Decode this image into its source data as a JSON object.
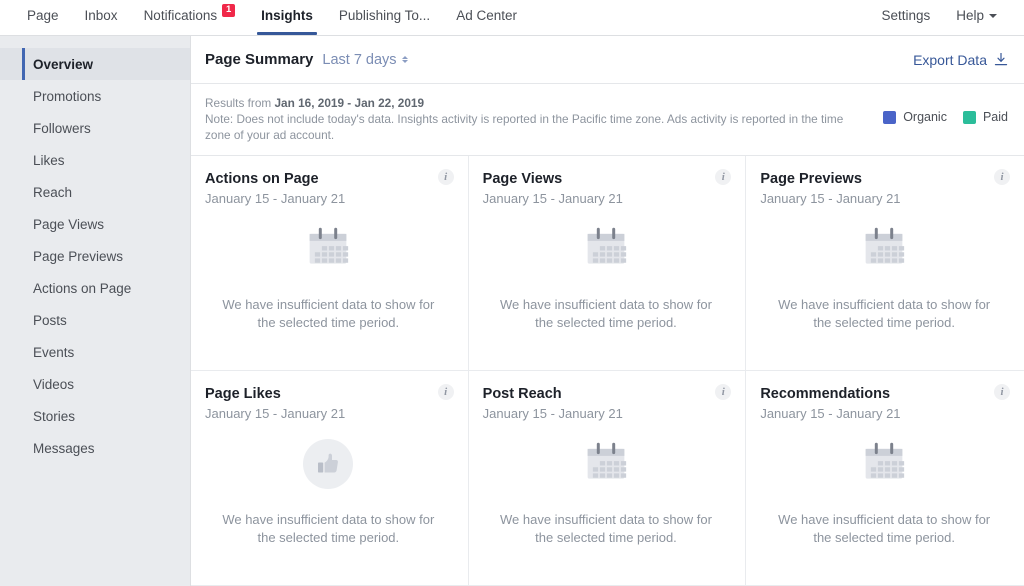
{
  "topnav": {
    "tabs": [
      {
        "label": "Page",
        "active": false,
        "badge": null
      },
      {
        "label": "Inbox",
        "active": false,
        "badge": null
      },
      {
        "label": "Notifications",
        "active": false,
        "badge": "1"
      },
      {
        "label": "Insights",
        "active": true,
        "badge": null
      },
      {
        "label": "Publishing To...",
        "active": false,
        "badge": null
      },
      {
        "label": "Ad Center",
        "active": false,
        "badge": null
      }
    ],
    "settings_label": "Settings",
    "help_label": "Help"
  },
  "sidebar": {
    "items": [
      {
        "label": "Overview",
        "active": true
      },
      {
        "label": "Promotions",
        "active": false
      },
      {
        "label": "Followers",
        "active": false
      },
      {
        "label": "Likes",
        "active": false
      },
      {
        "label": "Reach",
        "active": false
      },
      {
        "label": "Page Views",
        "active": false
      },
      {
        "label": "Page Previews",
        "active": false
      },
      {
        "label": "Actions on Page",
        "active": false
      },
      {
        "label": "Posts",
        "active": false
      },
      {
        "label": "Events",
        "active": false
      },
      {
        "label": "Videos",
        "active": false
      },
      {
        "label": "Stories",
        "active": false
      },
      {
        "label": "Messages",
        "active": false
      }
    ]
  },
  "summary": {
    "title": "Page Summary",
    "date_range_selector": "Last 7 days",
    "export_label": "Export Data",
    "results_prefix": "Results from ",
    "results_range": "Jan 16, 2019 - Jan 22, 2019",
    "note": "Note: Does not include today's data. Insights activity is reported in the Pacific time zone. Ads activity is reported in the time zone of your ad account.",
    "legend": [
      {
        "label": "Organic",
        "color": "#4a64c8"
      },
      {
        "label": "Paid",
        "color": "#2bbd9a"
      }
    ]
  },
  "cards": [
    {
      "title": "Actions on Page",
      "range": "January 15 - January 21",
      "empty_message": "We have insufficient data to show for the selected time period.",
      "icon": "calendar-icon"
    },
    {
      "title": "Page Views",
      "range": "January 15 - January 21",
      "empty_message": "We have insufficient data to show for the selected time period.",
      "icon": "calendar-icon"
    },
    {
      "title": "Page Previews",
      "range": "January 15 - January 21",
      "empty_message": "We have insufficient data to show for the selected time period.",
      "icon": "calendar-icon"
    },
    {
      "title": "Page Likes",
      "range": "January 15 - January 21",
      "empty_message": "We have insufficient data to show for the selected time period.",
      "icon": "thumbs-up-icon"
    },
    {
      "title": "Post Reach",
      "range": "January 15 - January 21",
      "empty_message": "We have insufficient data to show for the selected time period.",
      "icon": "calendar-icon"
    },
    {
      "title": "Recommendations",
      "range": "January 15 - January 21",
      "empty_message": "We have insufficient data to show for the selected time period.",
      "icon": "calendar-icon"
    }
  ]
}
